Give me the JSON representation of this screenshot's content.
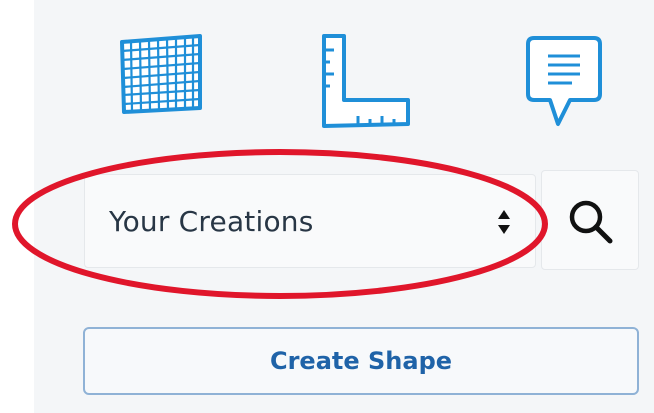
{
  "toolbar": {
    "tools": [
      {
        "name": "grid",
        "icon": "grid-icon"
      },
      {
        "name": "ruler",
        "icon": "ruler-icon"
      },
      {
        "name": "note",
        "icon": "note-bubble-icon"
      }
    ]
  },
  "collection_select": {
    "selected": "Your Creations",
    "icon": "sort-arrows-icon"
  },
  "search": {
    "icon": "search-icon"
  },
  "create_shape": {
    "label": "Create Shape"
  },
  "colors": {
    "icon_blue": "#1f8fd8",
    "button_text": "#1f63a8",
    "button_border": "#8fb2d6",
    "highlight_red": "#e0162b",
    "panel_bg": "#f4f6f8"
  }
}
